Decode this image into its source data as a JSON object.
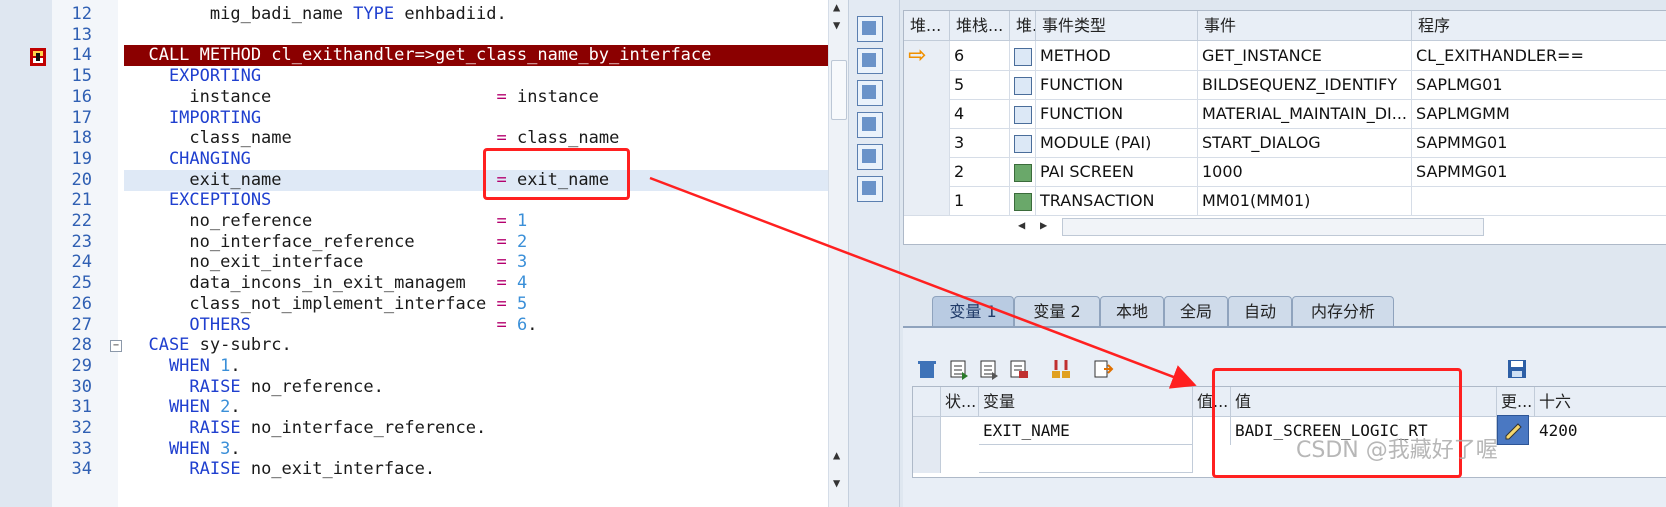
{
  "editor": {
    "lines": [
      {
        "no": "12",
        "parts": [
          {
            "t": "        mig_badi_name ",
            "c": ""
          },
          {
            "t": "TYPE",
            "c": "kw"
          },
          {
            "t": " enhbadiid.",
            "c": ""
          }
        ]
      },
      {
        "no": "13",
        "parts": []
      },
      {
        "no": "14",
        "parts": [
          {
            "t": "  CALL METHOD cl_exithandler=>get_class_name_by_interface",
            "c": ""
          }
        ]
      },
      {
        "no": "15",
        "parts": [
          {
            "t": "    EXPORTING",
            "c": "kw"
          }
        ]
      },
      {
        "no": "16",
        "parts": [
          {
            "t": "      instance                      ",
            "c": ""
          },
          {
            "t": "=",
            "c": "eq"
          },
          {
            "t": " instance",
            "c": ""
          }
        ]
      },
      {
        "no": "17",
        "parts": [
          {
            "t": "    IMPORTING",
            "c": "kw"
          }
        ]
      },
      {
        "no": "18",
        "parts": [
          {
            "t": "      class_name                    ",
            "c": ""
          },
          {
            "t": "=",
            "c": "eq"
          },
          {
            "t": " class_name",
            "c": ""
          }
        ]
      },
      {
        "no": "19",
        "parts": [
          {
            "t": "    CHANGING",
            "c": "kw"
          }
        ]
      },
      {
        "no": "20",
        "parts": [
          {
            "t": "      exit_name                     ",
            "c": ""
          },
          {
            "t": "=",
            "c": "eq"
          },
          {
            "t": " exit_name",
            "c": ""
          }
        ]
      },
      {
        "no": "21",
        "parts": [
          {
            "t": "    EXCEPTIONS",
            "c": "kw"
          }
        ]
      },
      {
        "no": "22",
        "parts": [
          {
            "t": "      no_reference                  ",
            "c": ""
          },
          {
            "t": "=",
            "c": "eq"
          },
          {
            "t": " ",
            "c": ""
          },
          {
            "t": "1",
            "c": "num"
          }
        ]
      },
      {
        "no": "23",
        "parts": [
          {
            "t": "      no_interface_reference        ",
            "c": ""
          },
          {
            "t": "=",
            "c": "eq"
          },
          {
            "t": " ",
            "c": ""
          },
          {
            "t": "2",
            "c": "num"
          }
        ]
      },
      {
        "no": "24",
        "parts": [
          {
            "t": "      no_exit_interface             ",
            "c": ""
          },
          {
            "t": "=",
            "c": "eq"
          },
          {
            "t": " ",
            "c": ""
          },
          {
            "t": "3",
            "c": "num"
          }
        ]
      },
      {
        "no": "25",
        "parts": [
          {
            "t": "      data_incons_in_exit_managem   ",
            "c": ""
          },
          {
            "t": "=",
            "c": "eq"
          },
          {
            "t": " ",
            "c": ""
          },
          {
            "t": "4",
            "c": "num"
          }
        ]
      },
      {
        "no": "26",
        "parts": [
          {
            "t": "      class_not_implement_interface ",
            "c": ""
          },
          {
            "t": "=",
            "c": "eq"
          },
          {
            "t": " ",
            "c": ""
          },
          {
            "t": "5",
            "c": "num"
          }
        ]
      },
      {
        "no": "27",
        "parts": [
          {
            "t": "      OTHERS",
            "c": "kw"
          },
          {
            "t": "                        ",
            "c": ""
          },
          {
            "t": "=",
            "c": "eq"
          },
          {
            "t": " ",
            "c": ""
          },
          {
            "t": "6",
            "c": "num"
          },
          {
            "t": ".",
            "c": ""
          }
        ]
      },
      {
        "no": "28",
        "parts": [
          {
            "t": "  CASE",
            "c": "kw"
          },
          {
            "t": " sy-subrc.",
            "c": ""
          }
        ]
      },
      {
        "no": "29",
        "parts": [
          {
            "t": "    WHEN",
            "c": "kw"
          },
          {
            "t": " ",
            "c": ""
          },
          {
            "t": "1",
            "c": "num"
          },
          {
            "t": ".",
            "c": ""
          }
        ]
      },
      {
        "no": "30",
        "parts": [
          {
            "t": "      RAISE",
            "c": "kw"
          },
          {
            "t": " no_reference.",
            "c": ""
          }
        ]
      },
      {
        "no": "31",
        "parts": [
          {
            "t": "    WHEN",
            "c": "kw"
          },
          {
            "t": " ",
            "c": ""
          },
          {
            "t": "2",
            "c": "num"
          },
          {
            "t": ".",
            "c": ""
          }
        ]
      },
      {
        "no": "32",
        "parts": [
          {
            "t": "      RAISE",
            "c": "kw"
          },
          {
            "t": " no_interface_reference.",
            "c": ""
          }
        ]
      },
      {
        "no": "33",
        "parts": [
          {
            "t": "    WHEN",
            "c": "kw"
          },
          {
            "t": " ",
            "c": ""
          },
          {
            "t": "3",
            "c": "num"
          },
          {
            "t": ".",
            "c": ""
          }
        ]
      },
      {
        "no": "34",
        "parts": [
          {
            "t": "      RAISE",
            "c": "kw"
          },
          {
            "t": " no_exit_interface.",
            "c": ""
          }
        ]
      }
    ],
    "current_line": "14",
    "cursor_line": "20"
  },
  "stack": {
    "headers": [
      "堆...",
      "堆栈...",
      "堆...",
      "事件类型",
      "事件",
      "程序"
    ],
    "rows": [
      {
        "marker": "arrow",
        "level": "6",
        "type_icon": "method-icon",
        "event_type": "METHOD",
        "event": "GET_INSTANCE",
        "program": "CL_EXITHANDLER=="
      },
      {
        "marker": "",
        "level": "5",
        "type_icon": "method-icon",
        "event_type": "FUNCTION",
        "event": "BILDSEQUENZ_IDENTIFY",
        "program": "SAPLMG01"
      },
      {
        "marker": "",
        "level": "4",
        "type_icon": "method-icon",
        "event_type": "FUNCTION",
        "event": "MATERIAL_MAINTAIN_DI...",
        "program": "SAPLMGMM"
      },
      {
        "marker": "",
        "level": "3",
        "type_icon": "method-icon",
        "event_type": "MODULE (PAI)",
        "event": "START_DIALOG",
        "program": "SAPMMG01"
      },
      {
        "marker": "",
        "level": "2",
        "type_icon": "screen-icon",
        "event_type": "PAI SCREEN",
        "event": "1000",
        "program": "SAPMMG01"
      },
      {
        "marker": "",
        "level": "1",
        "type_icon": "screen-icon",
        "event_type": "TRANSACTION",
        "event": "MM01(MM01)",
        "program": ""
      }
    ]
  },
  "tabs": [
    "变量 1",
    "变量 2",
    "本地",
    "全局",
    "自动",
    "内存分析"
  ],
  "active_tab": "变量 1",
  "variables": {
    "headers": [
      "状...",
      "变量",
      "值...",
      "值",
      "更...",
      "十六"
    ],
    "rows": [
      {
        "name": "EXIT_NAME",
        "value": "BADI_SCREEN_LOGIC_RT",
        "hex": "4200"
      }
    ]
  },
  "watermark": "CSDN @我藏好了喔",
  "colors": {
    "current_line_bg": "#8b0000",
    "annotation_red": "#ff2020",
    "keyword": "#1f3fcf"
  }
}
